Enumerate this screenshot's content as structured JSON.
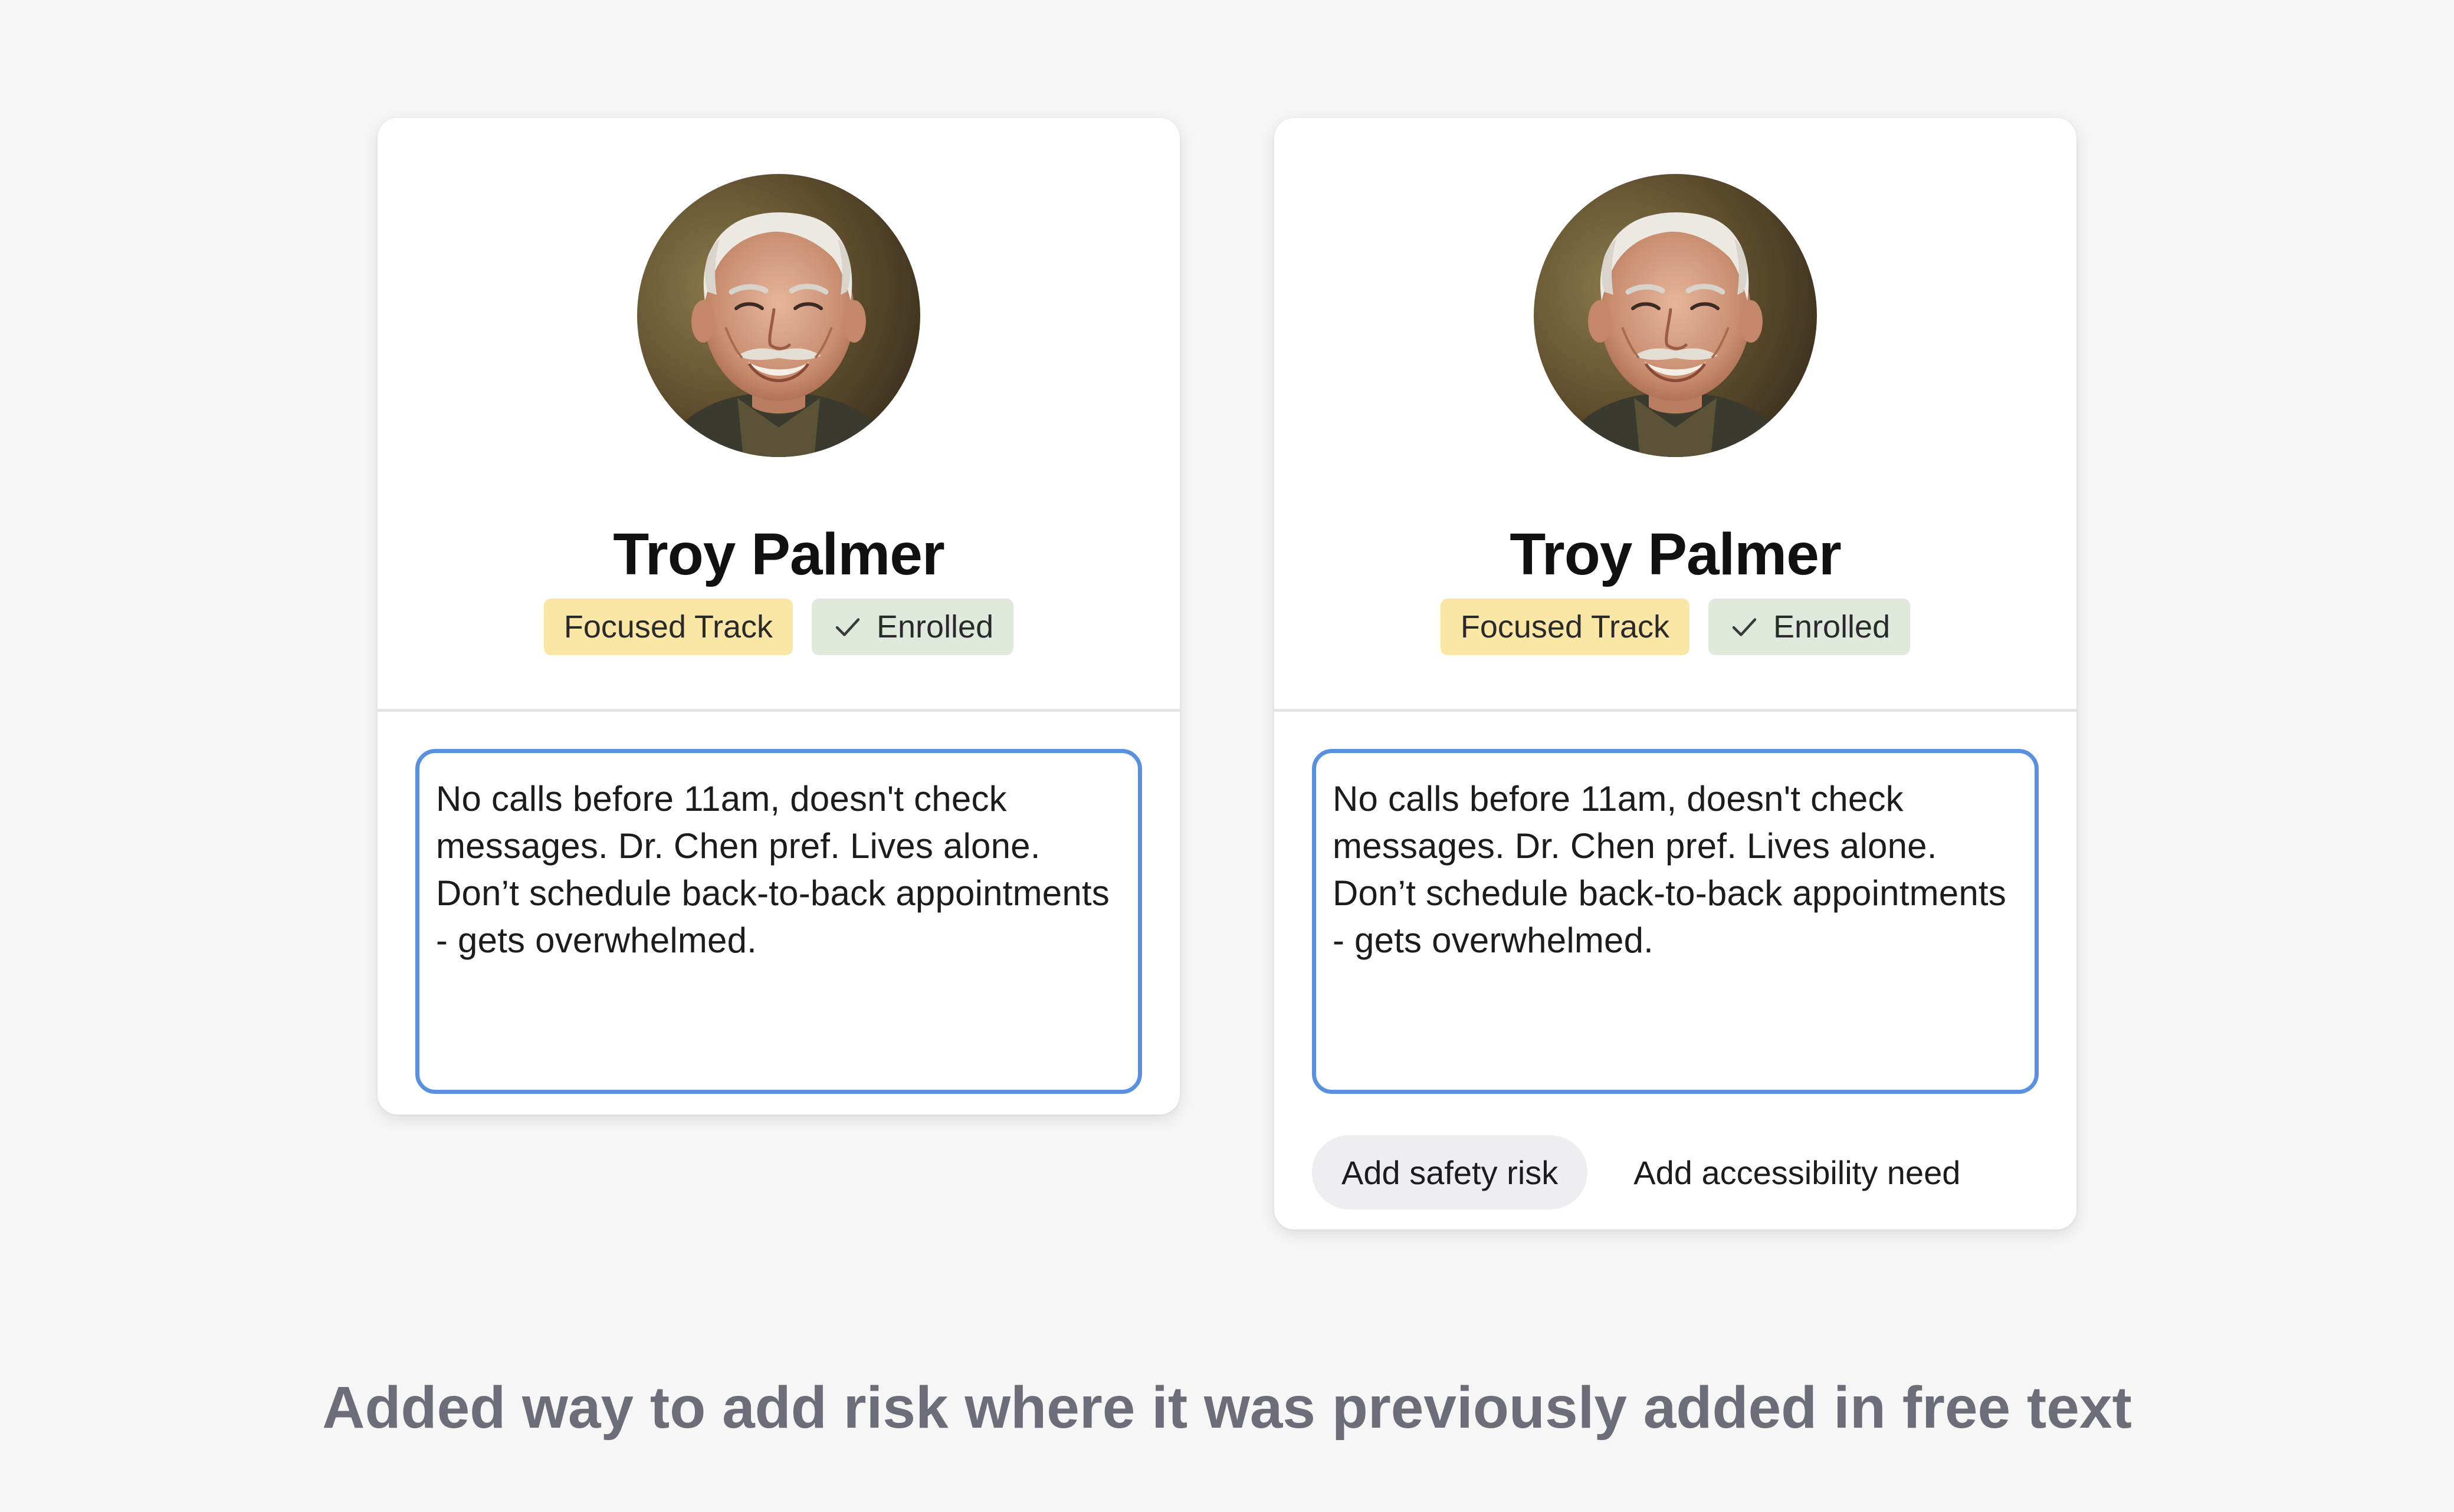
{
  "cards": {
    "before": {
      "patient_name": "Troy Palmer",
      "badges": {
        "track": "Focused Track",
        "status": "Enrolled",
        "status_icon": "check-icon"
      },
      "note_text": "No calls before 11am, doesn't check messages. Dr. Chen pref. Lives alone. Don’t schedule back-to-back appointments - gets overwhelmed."
    },
    "after": {
      "patient_name": "Troy Palmer",
      "badges": {
        "track": "Focused Track",
        "status": "Enrolled",
        "status_icon": "check-icon"
      },
      "note_text": "No calls before 11am, doesn't check messages. Dr. Chen pref. Lives alone. Don’t schedule back-to-back appointments - gets overwhelmed.",
      "actions": {
        "add_safety_risk": "Add safety risk",
        "add_accessibility_need": "Add accessibility need"
      }
    }
  },
  "caption": "Added way to add risk where it was previously added in free text",
  "colors": {
    "background": "#f6f6f6",
    "track_badge": "#fbe7a5",
    "enrolled_badge": "#dfeadc",
    "note_border": "#5a90e0",
    "chip_fill": "#eeeef0",
    "caption_text": "#6c6d78"
  }
}
